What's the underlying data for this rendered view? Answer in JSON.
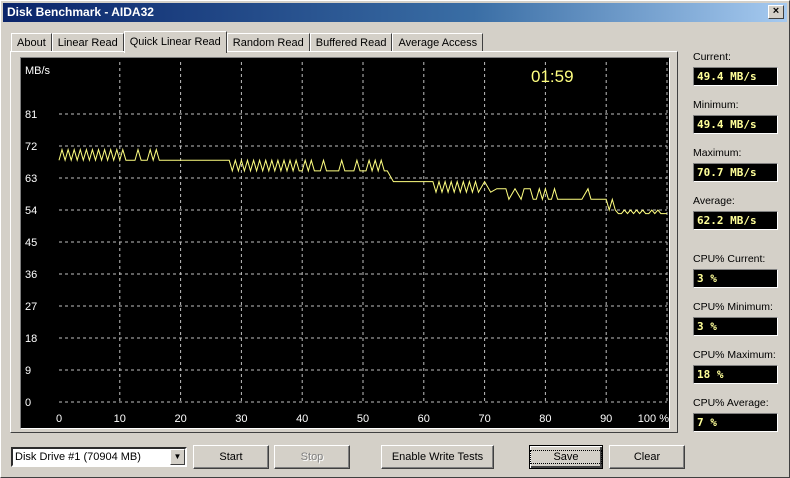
{
  "window": {
    "title": "Disk Benchmark - AIDA32",
    "close": "×"
  },
  "tabs": [
    {
      "label": "About"
    },
    {
      "label": "Linear Read"
    },
    {
      "label": "Quick Linear Read",
      "active": true
    },
    {
      "label": "Random Read"
    },
    {
      "label": "Buffered Read"
    },
    {
      "label": "Average Access"
    }
  ],
  "chart_data": {
    "type": "line",
    "timer": "01:59",
    "ylabel": "MB/s",
    "xlabel_suffix": "100 %",
    "ylim": [
      0,
      90
    ],
    "xlim": [
      0,
      100
    ],
    "yticks": [
      "0",
      "9",
      "18",
      "27",
      "36",
      "45",
      "54",
      "63",
      "72",
      "81"
    ],
    "xticks": [
      "0",
      "10",
      "20",
      "30",
      "40",
      "50",
      "60",
      "70",
      "80",
      "90"
    ],
    "grid": true,
    "line_color": "#ffff80",
    "x": [
      0,
      0.5,
      1,
      1.5,
      2,
      2.5,
      3,
      3.5,
      4,
      4.5,
      5,
      5.5,
      6,
      6.5,
      7,
      7.5,
      8,
      8.5,
      9,
      9.5,
      10,
      10.5,
      11,
      11.5,
      12,
      12.5,
      13,
      13.5,
      14,
      14.5,
      15,
      15.5,
      16,
      16.5,
      17,
      20,
      25,
      28,
      28.5,
      29,
      29.5,
      30,
      30.5,
      31,
      31.5,
      32,
      32.5,
      33,
      33.5,
      34,
      34.5,
      35,
      35.5,
      36,
      36.5,
      37,
      37.5,
      38,
      38.5,
      39,
      39.5,
      40,
      40.5,
      41,
      41.5,
      42,
      42.5,
      43,
      43.5,
      44,
      44.5,
      45,
      45.5,
      46,
      46.5,
      47,
      47.5,
      48,
      48.5,
      49,
      49.5,
      50,
      50.5,
      51,
      51.5,
      52,
      52.5,
      53,
      53.5,
      54,
      55,
      60,
      61,
      61.5,
      62,
      62.5,
      63,
      63.5,
      64,
      64.5,
      65,
      65.5,
      66,
      66.5,
      67,
      67.5,
      68,
      68.5,
      69,
      70,
      71,
      72,
      72.5,
      73,
      73.5,
      74,
      75,
      76,
      76.5,
      77,
      77.5,
      78,
      78.5,
      79,
      79.5,
      80,
      80.5,
      81,
      81.5,
      82,
      86,
      87,
      87.5,
      88,
      88.5,
      89,
      89.5,
      90,
      90.5,
      91,
      91.5,
      92,
      92.5,
      93,
      93.5,
      94,
      94.5,
      95,
      95.5,
      96,
      96.5,
      97,
      97.5,
      98,
      98.5,
      99,
      99.5,
      100
    ],
    "y": [
      68,
      71,
      68,
      71,
      68,
      71,
      68,
      71,
      68,
      71,
      68,
      71,
      68,
      71,
      68,
      71,
      68,
      71,
      68,
      71,
      68,
      71,
      68,
      68,
      68,
      68,
      71,
      68,
      68,
      68,
      71,
      68,
      71,
      68,
      68,
      68,
      68,
      68,
      65,
      68,
      65,
      68,
      65,
      68,
      65,
      68,
      65,
      68,
      65,
      68,
      65,
      68,
      65,
      68,
      65,
      68,
      65,
      68,
      65,
      68,
      65,
      65,
      68,
      65,
      68,
      65,
      65,
      65,
      68,
      65,
      65,
      65,
      65,
      65,
      68,
      65,
      65,
      65,
      65,
      68,
      65,
      65,
      65,
      68,
      65,
      68,
      65,
      68,
      65,
      65,
      62,
      62,
      62,
      62,
      59,
      62,
      59,
      62,
      59,
      62,
      59,
      62,
      59,
      62,
      59,
      62,
      59,
      62,
      59,
      62,
      59,
      60,
      60,
      60,
      60,
      57,
      60,
      57,
      60,
      60,
      60,
      57,
      57,
      60,
      57,
      60,
      57,
      57,
      60,
      57,
      57,
      60,
      57,
      57,
      57,
      57,
      57,
      57,
      54,
      57,
      54,
      53,
      53,
      54,
      53,
      54,
      53,
      54,
      53,
      54,
      53,
      53,
      54,
      53,
      54,
      53,
      53,
      53,
      54,
      52,
      54,
      51,
      53,
      50,
      52,
      50,
      51,
      50,
      49.4
    ]
  },
  "stats": [
    {
      "label": "Current:",
      "value": "49.4 MB/s"
    },
    {
      "label": "Minimum:",
      "value": "49.4 MB/s"
    },
    {
      "label": "Maximum:",
      "value": "70.7 MB/s"
    },
    {
      "label": "Average:",
      "value": "62.2 MB/s"
    },
    {
      "label": "CPU% Current:",
      "value": "3 %"
    },
    {
      "label": "CPU% Minimum:",
      "value": "3 %"
    },
    {
      "label": "CPU% Maximum:",
      "value": "18 %"
    },
    {
      "label": "CPU% Average:",
      "value": "7 %"
    }
  ],
  "controls": {
    "drive_select": "Disk Drive #1  (70904 MB)",
    "start": "Start",
    "stop": "Stop",
    "write_tests": "Enable Write Tests",
    "save": "Save",
    "clear": "Clear"
  }
}
